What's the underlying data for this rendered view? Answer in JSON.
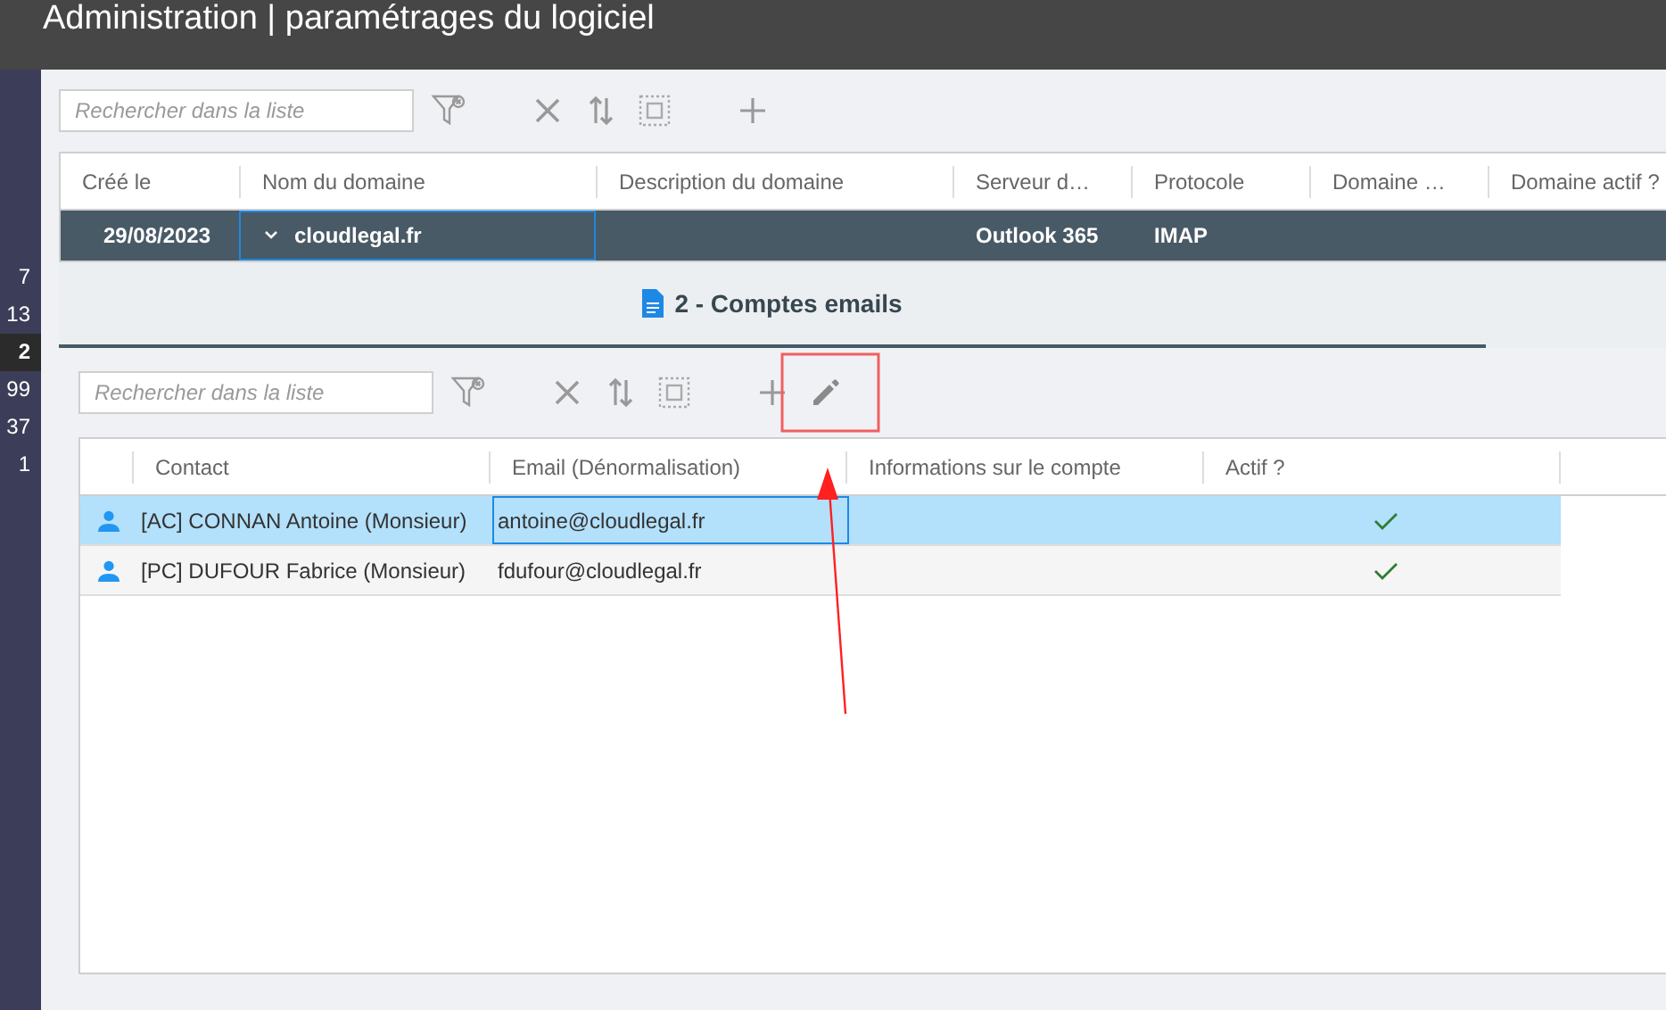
{
  "window": {
    "title": "Administration | paramétrages du logiciel"
  },
  "sidebar": {
    "items": [
      {
        "label": "7",
        "selected": false
      },
      {
        "label": "13",
        "selected": false
      },
      {
        "label": "2",
        "selected": true
      },
      {
        "label": "99",
        "selected": false
      },
      {
        "label": "37",
        "selected": false
      },
      {
        "label": "1",
        "selected": false
      }
    ]
  },
  "domains": {
    "search": {
      "placeholder": "Rechercher dans la liste"
    },
    "columns": [
      "Créé le",
      "Nom du domaine",
      "Description du domaine",
      "Serveur d…",
      "Protocole",
      "Domaine …",
      "Domaine actif ?"
    ],
    "rows": [
      {
        "selected": true,
        "expanded": true,
        "cells": [
          {
            "text": "29/08/2023",
            "focused": false
          },
          {
            "text": "cloudlegal.fr",
            "focused": true
          },
          {
            "focused": false
          },
          {
            "text": "Outlook 365",
            "focused": false
          },
          {
            "text": "IMAP",
            "focused": false
          },
          {
            "focused": false
          },
          {
            "focused": false
          }
        ]
      }
    ]
  },
  "detail_tab": {
    "label": "2 - Comptes emails",
    "selected": true
  },
  "accounts": {
    "search": {
      "placeholder": "Rechercher dans la liste"
    },
    "columns": [
      "Contact",
      "Email (Dénormalisation)",
      "Informations sur le compte",
      "Actif ?"
    ],
    "rows": [
      {
        "selected": true,
        "contact": "[AC] CONNAN Antoine (Monsieur)",
        "email": "antoine@cloudlegal.fr",
        "email_focused": true,
        "active": true
      },
      {
        "selected": false,
        "contact": "[PC] DUFOUR Fabrice (Monsieur)",
        "email": "fdufour@cloudlegal.fr",
        "email_focused": false,
        "active": true
      }
    ]
  }
}
